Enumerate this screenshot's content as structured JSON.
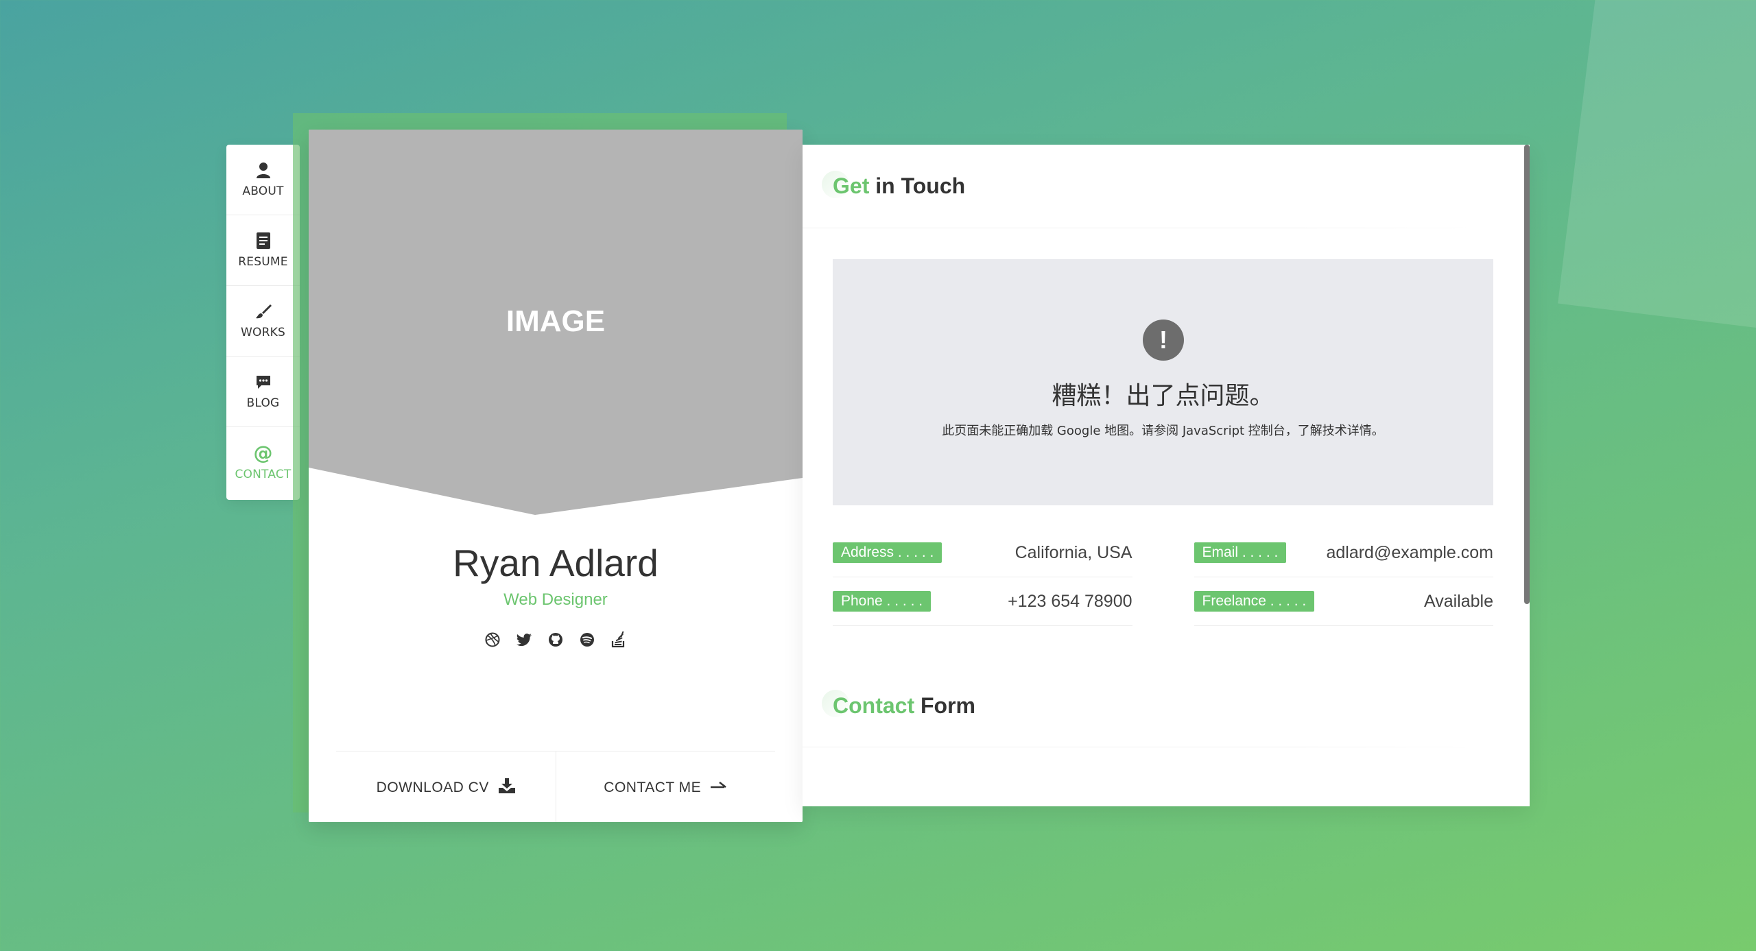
{
  "nav": {
    "items": [
      {
        "label": "ABOUT",
        "icon": "user-icon"
      },
      {
        "label": "RESUME",
        "icon": "document-icon"
      },
      {
        "label": "WORKS",
        "icon": "brush-icon"
      },
      {
        "label": "BLOG",
        "icon": "chat-icon"
      },
      {
        "label": "CONTACT",
        "icon": "at-icon",
        "active": true
      }
    ]
  },
  "profile": {
    "image_label": "IMAGE",
    "name": "Ryan Adlard",
    "role": "Web Designer",
    "social": [
      "dribbble-icon",
      "twitter-icon",
      "github-icon",
      "spotify-icon",
      "stackoverflow-icon"
    ],
    "download_cv": "DOWNLOAD CV",
    "contact_me": "CONTACT ME"
  },
  "contact": {
    "title_highlight": "Get",
    "title_rest": " in Touch",
    "map_error_title": "糟糕！出了点问题。",
    "map_error_text": "此页面未能正确加载 Google 地图。请参阅 JavaScript 控制台，了解技术详情。",
    "info": [
      {
        "label": "Address . . . . .",
        "value": "California, USA"
      },
      {
        "label": "Email . . . . .",
        "value": "adlard@example.com"
      },
      {
        "label": "Phone . . . . .",
        "value": "+123 654 78900"
      },
      {
        "label": "Freelance . . . . .",
        "value": "Available"
      }
    ],
    "form_title_highlight": "Contact",
    "form_title_rest": " Form"
  },
  "colors": {
    "accent": "#6cc56f",
    "image_placeholder": "#b4b4b4"
  }
}
